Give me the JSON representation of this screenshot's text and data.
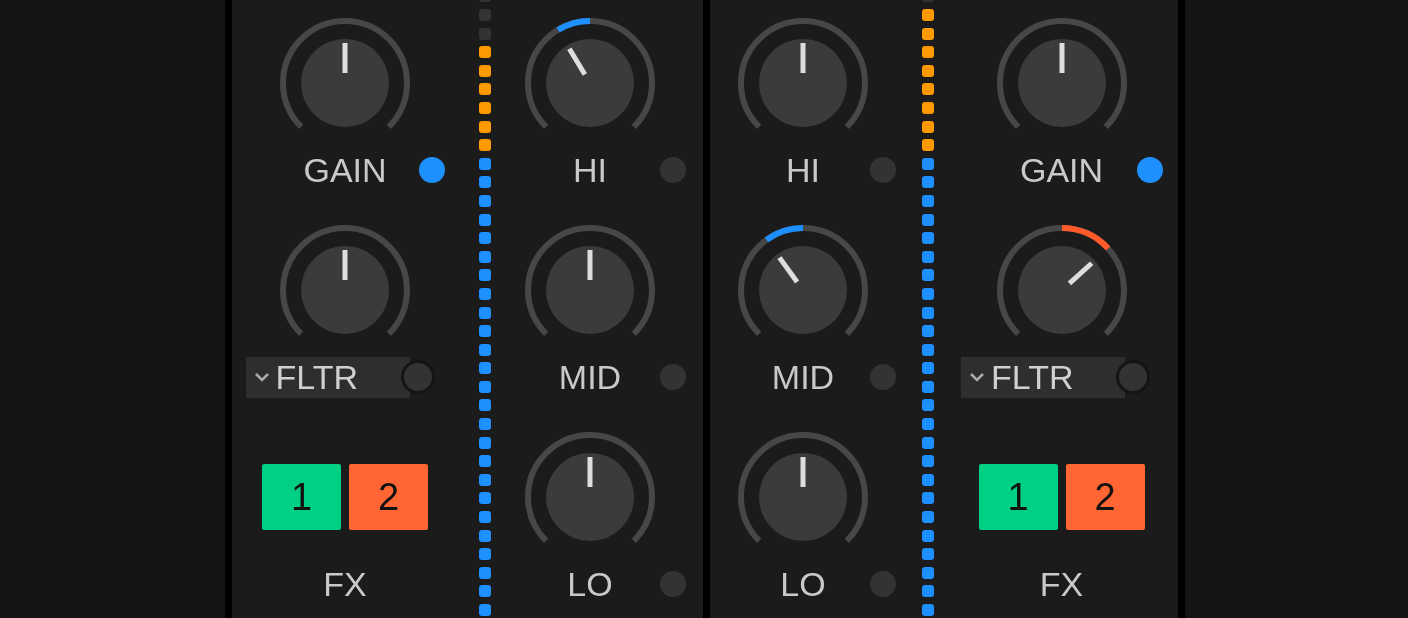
{
  "channels": [
    {
      "deck": {
        "gain": {
          "label": "GAIN",
          "on": true
        },
        "filter": {
          "label": "FLTR",
          "on": false
        },
        "fx": {
          "label": "FX",
          "buttons": [
            {
              "label": "1",
              "color": "#00d084"
            },
            {
              "label": "2",
              "color": "#ff6633"
            }
          ]
        }
      },
      "meter": {
        "level": 0.91
      },
      "eq": [
        {
          "label": "HI",
          "on": false
        },
        {
          "label": "MID",
          "on": false
        },
        {
          "label": "LO",
          "on": false
        }
      ]
    },
    {
      "deck": {
        "gain": {
          "label": "GAIN",
          "on": true
        },
        "filter": {
          "label": "FLTR",
          "on": false
        },
        "fx": {
          "label": "FX",
          "buttons": [
            {
              "label": "1",
              "color": "#00d084"
            },
            {
              "label": "2",
              "color": "#ff6633"
            }
          ]
        }
      },
      "meter": {
        "level": 0.97
      },
      "eq": [
        {
          "label": "HI",
          "on": false
        },
        {
          "label": "MID",
          "on": false
        },
        {
          "label": "LO",
          "on": false
        }
      ]
    }
  ]
}
